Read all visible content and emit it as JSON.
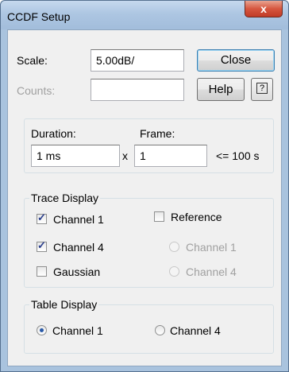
{
  "window": {
    "title": "CCDF Setup",
    "close_glyph": "x"
  },
  "scale": {
    "label": "Scale:",
    "value": "5.00dB/"
  },
  "counts": {
    "label": "Counts:",
    "value": ""
  },
  "buttons": {
    "close": "Close",
    "help": "Help",
    "whats_this_glyph": "?"
  },
  "timing": {
    "duration_label": "Duration:",
    "duration_value": "1 ms",
    "times_symbol": "x",
    "frame_label": "Frame:",
    "frame_value": "1",
    "limit_text": "<= 100 s"
  },
  "trace_display": {
    "title": "Trace Display",
    "channel1": {
      "label": "Channel 1",
      "checked": true
    },
    "channel4": {
      "label": "Channel 4",
      "checked": true
    },
    "gaussian": {
      "label": "Gaussian",
      "checked": false
    },
    "reference": {
      "label": "Reference",
      "checked": false
    },
    "ref_channel1": {
      "label": "Channel 1",
      "enabled": false
    },
    "ref_channel4": {
      "label": "Channel 4",
      "enabled": false
    }
  },
  "table_display": {
    "title": "Table Display",
    "channel1": {
      "label": "Channel 1",
      "selected": true
    },
    "channel4": {
      "label": "Channel 4",
      "selected": false
    }
  },
  "colors": {
    "title_bar": "#adc6e2",
    "close_button": "#c94a35",
    "dialog_bg": "#f0f0f0"
  }
}
